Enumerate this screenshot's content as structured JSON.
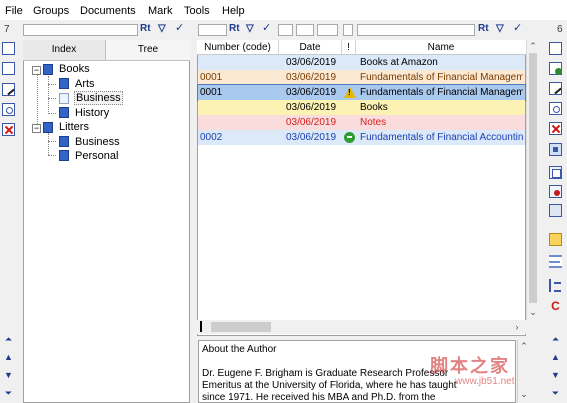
{
  "menu": [
    "File",
    "Groups",
    "Documents",
    "Mark",
    "Tools",
    "Help"
  ],
  "filter_bar": {
    "left_count": "7",
    "right_count": "6",
    "sort_icon": "Rt",
    "check_icon": "✓"
  },
  "tree": {
    "tabs": [
      "Index",
      "Tree"
    ],
    "nodes": [
      {
        "label": "Books",
        "level": 0,
        "expanded": true
      },
      {
        "label": "Arts",
        "level": 1
      },
      {
        "label": "Business",
        "level": 1,
        "selected": true
      },
      {
        "label": "History",
        "level": 1
      },
      {
        "label": "Litters",
        "level": 0,
        "expanded": true
      },
      {
        "label": "Business",
        "level": 1
      },
      {
        "label": "Personal",
        "level": 1
      }
    ]
  },
  "list": {
    "columns": [
      "Number (code)",
      "Date",
      "!",
      "Name"
    ],
    "rows": [
      {
        "number": "",
        "date": "03/06/2019",
        "flag": "",
        "name": "Books at Amazon",
        "bg": "#dbe9f9",
        "fg": "#000000"
      },
      {
        "number": "0001",
        "date": "03/06/2019",
        "flag": "",
        "name": "Fundamentals of Financial Management",
        "bg": "#fbe9d4",
        "fg": "#7a3d00"
      },
      {
        "number": "0001",
        "date": "03/06/2019",
        "flag": "warning",
        "name": "Fundamentals of Financial Management",
        "bg": "#a9c9ef",
        "fg": "#000000",
        "selected": true
      },
      {
        "number": "",
        "date": "03/06/2019",
        "flag": "",
        "name": "Books",
        "bg": "#fbf2b3",
        "fg": "#000000"
      },
      {
        "number": "",
        "date": "03/06/2019",
        "flag": "",
        "name": "Notes",
        "bg": "#fbdcdc",
        "fg": "#d81e1e"
      },
      {
        "number": "0002",
        "date": "03/06/2019",
        "flag": "ok",
        "name": "Fundamentals of Financial Accounting",
        "bg": "#dbe9f9",
        "fg": "#1c3fb0"
      }
    ]
  },
  "about": {
    "title": "About the Author",
    "lines": [
      "Dr. Eugene F. Brigham is Graduate Research Professor",
      "Emeritus at the University of Florida, where he has taught",
      "since 1971. He received his MBA and Ph.D. from the"
    ]
  },
  "right_toolbar": {
    "c_label": "C"
  },
  "watermark": {
    "main": "脚本之家",
    "sub": "www.jb51.net"
  },
  "colors": {
    "accent": "#1c3d8c",
    "selection": "#a9c9ef"
  }
}
